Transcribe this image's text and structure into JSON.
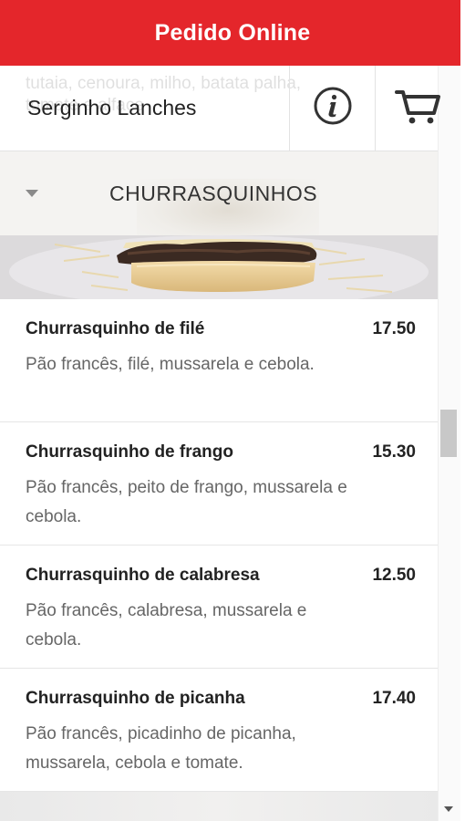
{
  "titlebar": {
    "title": "Pedido Online"
  },
  "header": {
    "store_name": "Serginho Lanches",
    "background_text": "tutaia, cenoura, milho, batata palha, tomate e alface",
    "info_icon": "info-icon",
    "cart_icon": "cart-icon"
  },
  "category": {
    "title": "CHURRASQUINHOS",
    "toggle_icon": "triangle-down-icon"
  },
  "items": [
    {
      "name": "Churrasquinho de filé",
      "price": "17.50",
      "description": "Pão francês, filé, mussarela e cebola."
    },
    {
      "name": "Churrasquinho de frango",
      "price": "15.30",
      "description": "Pão francês, peito de frango, mussarela e cebola."
    },
    {
      "name": "Churrasquinho de calabresa",
      "price": "12.50",
      "description": "Pão francês, calabresa, mussarela e cebola."
    },
    {
      "name": "Churrasquinho de picanha",
      "price": "17.40",
      "description": "Pão francês, picadinho de picanha, mussarela, cebola e tomate."
    }
  ],
  "colors": {
    "brand": "#e4262b",
    "text": "#222222",
    "muted": "#666666"
  }
}
